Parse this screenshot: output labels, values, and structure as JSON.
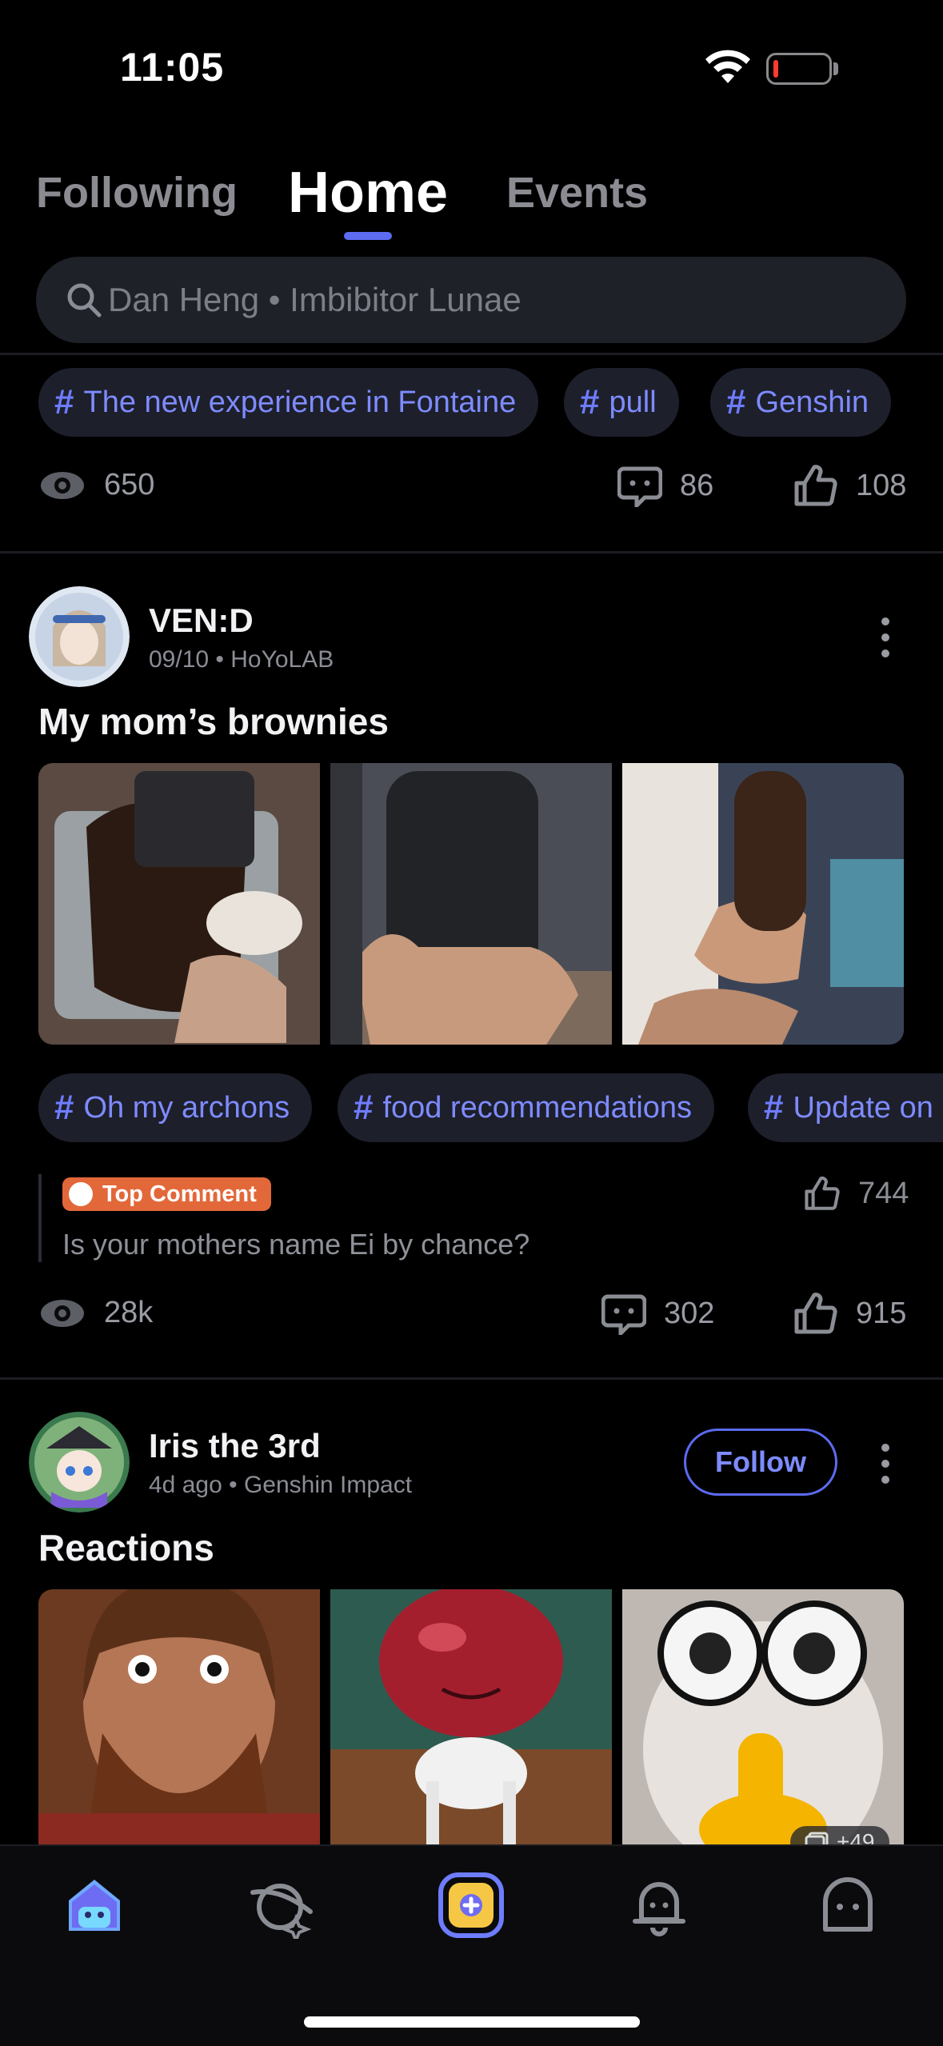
{
  "status_bar": {
    "time": "11:05"
  },
  "tabs": [
    {
      "label": "Following"
    },
    {
      "label": "Home",
      "active": true
    },
    {
      "label": "Events"
    }
  ],
  "search": {
    "placeholder": "Dan Heng • Imbibitor Lunae"
  },
  "prev_post": {
    "tags": [
      "The new experience in Fontaine",
      "pull",
      "Genshin"
    ],
    "views": "650",
    "comments": "86",
    "likes": "108"
  },
  "post1": {
    "author": "VEN:D",
    "date": "09/10",
    "source": "HoYoLAB",
    "title": "My mom’s brownies",
    "tags": [
      "Oh my archons",
      "food recommendations",
      "Update on"
    ],
    "top_comment": {
      "badge": "Top Comment",
      "text": "Is your mothers name Ei by chance?",
      "likes": "744"
    },
    "views": "28k",
    "comments": "302",
    "likes": "915"
  },
  "post2": {
    "author": "Iris the 3rd",
    "date": "4d ago",
    "source": "Genshin Impact",
    "follow_label": "Follow",
    "title": "Reactions",
    "more_images": "+49"
  },
  "bottom_nav": [
    "home-icon",
    "discover-planet-icon",
    "create-post-icon",
    "notifications-bell-icon",
    "profile-icon"
  ],
  "colors": {
    "accent": "#5c6bf0",
    "tag_text": "#7e8bff",
    "badge": "#e2683a",
    "background": "#000000"
  }
}
